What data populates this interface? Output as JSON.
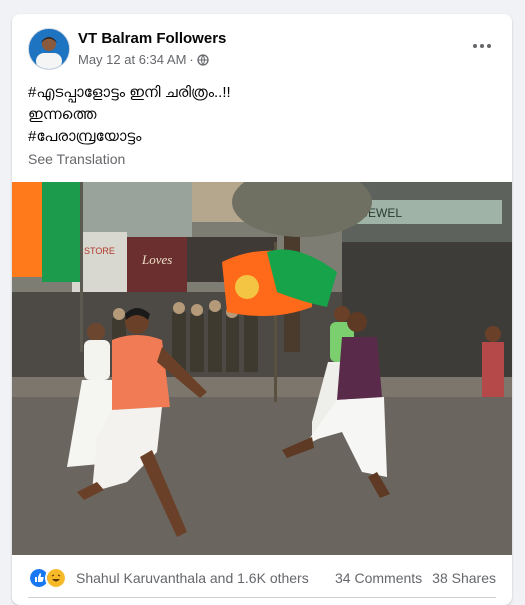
{
  "post": {
    "page_name": "VT Balram Followers",
    "timestamp": "May 12 at 6:34 AM",
    "separator": "·",
    "caption_lines": [
      "#എടപ്പാളോട്ടം ഇനി ചരിത്രം..!!",
      "ഇന്നത്തെ",
      "#പേരാമ്പ്രയോട്ടം"
    ],
    "see_translation": "See Translation"
  },
  "photo": {
    "signs": [
      "Loves",
      "STORE",
      "JEWEL"
    ]
  },
  "footer": {
    "likers": "Shahul Karuvanthala and 1.6K others",
    "comments": "34 Comments",
    "shares": "38 Shares"
  },
  "colors": {
    "like_blue": "#1877f2",
    "haha_yellow": "#f7b928",
    "text_secondary": "#65676b",
    "bjp_saffron": "#ff6a1a",
    "bjp_green": "#16a34a"
  }
}
